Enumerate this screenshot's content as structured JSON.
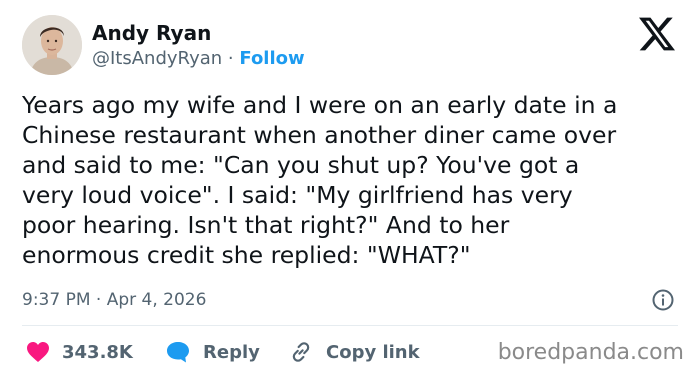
{
  "author": {
    "name": "Andy Ryan",
    "handle": "@ItsAndyRyan",
    "separator": "·",
    "follow_label": "Follow"
  },
  "post": {
    "text": "Years ago my wife and I were on an early date in a\nChinese restaurant when another diner came over\nand said to me: \"Can you shut up? You've got a\nvery loud voice\". I said: \"My girlfriend has very\npoor hearing. Isn't that right?\" And to her\nenormous credit she replied: \"WHAT?\"",
    "timestamp": "9:37 PM · Apr 4, 2026"
  },
  "actions": {
    "like_count": "343.8K",
    "reply_label": "Reply",
    "copy_link_label": "Copy link"
  },
  "watermark": "boredpanda.com",
  "colors": {
    "text": "#0f1419",
    "secondary": "#536471",
    "link": "#1d9bf0",
    "heart": "#f91880",
    "reply_bubble": "#1d9bf0"
  },
  "icons": [
    "avatar",
    "x-logo-icon",
    "info-icon",
    "heart-icon",
    "reply-bubble-icon",
    "link-icon"
  ]
}
